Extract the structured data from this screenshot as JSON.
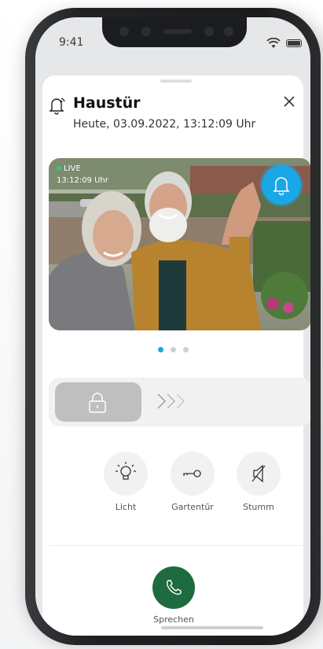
{
  "status_bar": {
    "time": "9:41"
  },
  "header": {
    "title": "Haustür",
    "subtitle": "Heute, 03.09.2022, 13:12:09 Uhr"
  },
  "video": {
    "live_label": "LIVE",
    "live_time": "13:12:09 Uhr"
  },
  "pager": {
    "count": 3,
    "active_index": 0
  },
  "actions": [
    {
      "label": "Licht",
      "icon": "light-bulb-icon"
    },
    {
      "label": "Gartentür",
      "icon": "key-icon"
    },
    {
      "label": "Stumm",
      "icon": "mute-icon"
    }
  ],
  "talk": {
    "label": "Sprechen",
    "icon": "phone-icon"
  },
  "colors": {
    "accent_blue": "#1aa7e6",
    "talk_green": "#1d6b3f",
    "live_green": "#2ecc71"
  }
}
